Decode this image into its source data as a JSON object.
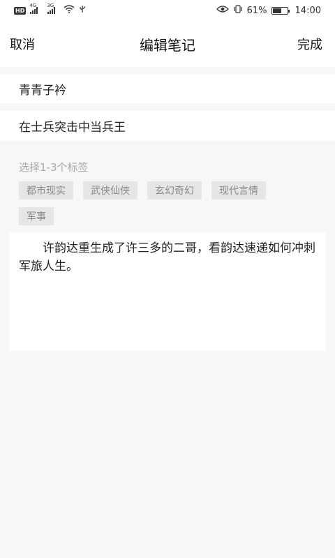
{
  "status_bar": {
    "hd": "HD",
    "sim1_net": "4G",
    "sim2_net": "3G",
    "battery_text": "61%",
    "battery_level": 0.61,
    "time": "14:00"
  },
  "header": {
    "cancel_label": "取消",
    "title": "编辑笔记",
    "done_label": "完成"
  },
  "note": {
    "title": "青青子衿",
    "subtitle": "在士兵突击中当兵王",
    "content": "许韵达重生成了许三多的二哥，看韵达速递如何冲刺军旅人生。"
  },
  "tags": {
    "hint": "选择1-3个标签",
    "items": [
      "都市现实",
      "武侠仙侠",
      "玄幻奇幻",
      "现代言情",
      "军事"
    ]
  }
}
